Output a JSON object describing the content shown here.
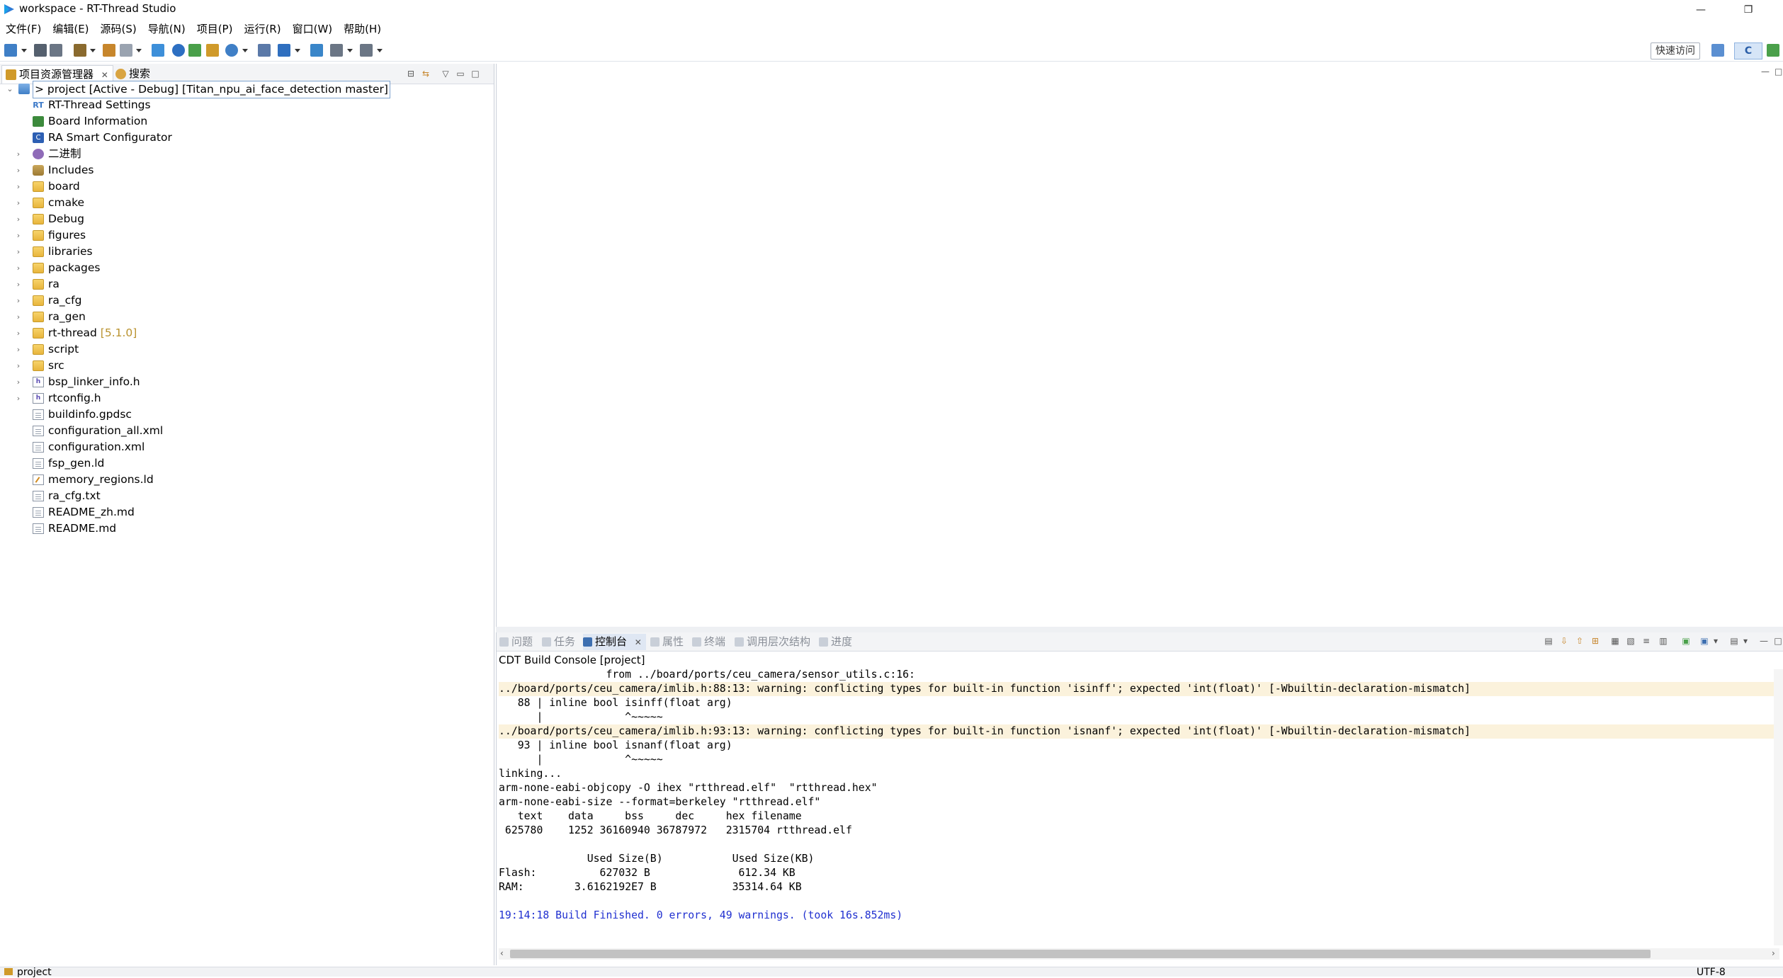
{
  "window": {
    "title": "workspace - RT-Thread Studio"
  },
  "menu": [
    "文件(F)",
    "编辑(E)",
    "源码(S)",
    "导航(N)",
    "项目(P)",
    "运行(R)",
    "窗口(W)",
    "帮助(H)"
  ],
  "toolbar": {
    "quick_access": "快速访问",
    "perspective_label": "C"
  },
  "left_panel": {
    "tabs": [
      {
        "label": "项目资源管理器",
        "active": true
      },
      {
        "label": "搜索",
        "active": false
      }
    ],
    "tree": [
      {
        "label": "> project",
        "suffix": "[Active - Debug] [Titan_npu_ai_face_detection master]",
        "icon": "project-icon",
        "level": 0,
        "expanded": true
      },
      {
        "label": "RT-Thread Settings",
        "icon": "rt-thread-settings-icon",
        "level": 1
      },
      {
        "label": "Board Information",
        "icon": "board-icon",
        "level": 1
      },
      {
        "label": "RA Smart Configurator",
        "icon": "ra-configurator-icon",
        "level": 1
      },
      {
        "label": "二进制",
        "icon": "binaries-icon",
        "level": 1,
        "collapsed": true
      },
      {
        "label": "Includes",
        "icon": "includes-icon",
        "level": 1,
        "collapsed": true
      },
      {
        "label": "board",
        "icon": "folder-icon",
        "level": 1,
        "collapsed": true
      },
      {
        "label": "cmake",
        "icon": "folder-icon",
        "level": 1,
        "collapsed": true
      },
      {
        "label": "Debug",
        "icon": "folder-icon",
        "level": 1,
        "collapsed": true
      },
      {
        "label": "figures",
        "icon": "folder-icon",
        "level": 1,
        "collapsed": true
      },
      {
        "label": "libraries",
        "icon": "folder-icon",
        "level": 1,
        "collapsed": true
      },
      {
        "label": "packages",
        "icon": "folder-icon",
        "level": 1,
        "collapsed": true
      },
      {
        "label": "ra",
        "icon": "folder-icon",
        "level": 1,
        "collapsed": true
      },
      {
        "label": "ra_cfg",
        "icon": "folder-icon",
        "level": 1,
        "collapsed": true
      },
      {
        "label": "ra_gen",
        "icon": "folder-icon",
        "level": 1,
        "collapsed": true
      },
      {
        "label": "rt-thread",
        "version": "[5.1.0]",
        "icon": "folder-icon",
        "level": 1,
        "collapsed": true
      },
      {
        "label": "script",
        "icon": "folder-icon",
        "level": 1,
        "collapsed": true
      },
      {
        "label": "src",
        "icon": "folder-icon",
        "level": 1,
        "collapsed": true
      },
      {
        "label": "bsp_linker_info.h",
        "icon": "header-file-icon",
        "level": 1,
        "collapsed": true
      },
      {
        "label": "rtconfig.h",
        "icon": "header-file-icon",
        "level": 1,
        "collapsed": true
      },
      {
        "label": "buildinfo.gpdsc",
        "icon": "file-icon",
        "level": 1
      },
      {
        "label": "configuration_all.xml",
        "icon": "file-icon",
        "level": 1
      },
      {
        "label": "configuration.xml",
        "icon": "file-icon",
        "level": 1
      },
      {
        "label": "fsp_gen.ld",
        "icon": "file-icon",
        "level": 1
      },
      {
        "label": "memory_regions.ld",
        "icon": "linker-file-icon",
        "level": 1
      },
      {
        "label": "ra_cfg.txt",
        "icon": "file-icon",
        "level": 1
      },
      {
        "label": "README_zh.md",
        "icon": "file-icon",
        "level": 1
      },
      {
        "label": "README.md",
        "icon": "file-icon",
        "level": 1
      }
    ]
  },
  "console_panel": {
    "tabs": [
      {
        "label": "问题",
        "active": false
      },
      {
        "label": "任务",
        "active": false
      },
      {
        "label": "控制台",
        "active": true
      },
      {
        "label": "属性",
        "active": false
      },
      {
        "label": "终端",
        "active": false
      },
      {
        "label": "调用层次结构",
        "active": false
      },
      {
        "label": "进度",
        "active": false
      }
    ],
    "title": "CDT Build Console [project]",
    "lines": [
      {
        "text": "                 from ../board/ports/ceu_camera/sensor_utils.c:16:",
        "kind": "normal"
      },
      {
        "text": "../board/ports/ceu_camera/imlib.h:88:13: warning: conflicting types for built-in function 'isinff'; expected 'int(float)' [-Wbuiltin-declaration-mismatch]",
        "kind": "warn"
      },
      {
        "text": "   88 | inline bool isinff(float arg)",
        "kind": "normal"
      },
      {
        "text": "      |             ^~~~~~",
        "kind": "normal"
      },
      {
        "text": "../board/ports/ceu_camera/imlib.h:93:13: warning: conflicting types for built-in function 'isnanf'; expected 'int(float)' [-Wbuiltin-declaration-mismatch]",
        "kind": "warn"
      },
      {
        "text": "   93 | inline bool isnanf(float arg)",
        "kind": "normal"
      },
      {
        "text": "      |             ^~~~~~",
        "kind": "normal"
      },
      {
        "text": "linking...",
        "kind": "normal"
      },
      {
        "text": "arm-none-eabi-objcopy -O ihex \"rtthread.elf\"  \"rtthread.hex\"",
        "kind": "normal"
      },
      {
        "text": "arm-none-eabi-size --format=berkeley \"rtthread.elf\"",
        "kind": "normal"
      },
      {
        "text": "   text    data     bss     dec     hex filename",
        "kind": "normal"
      },
      {
        "text": " 625780    1252 36160940 36787972   2315704 rtthread.elf",
        "kind": "normal"
      },
      {
        "text": "",
        "kind": "normal"
      },
      {
        "text": "              Used Size(B)           Used Size(KB)",
        "kind": "normal"
      },
      {
        "text": "Flash:          627032 B              612.34 KB",
        "kind": "normal"
      },
      {
        "text": "RAM:        3.6162192E7 B            35314.64 KB",
        "kind": "normal"
      },
      {
        "text": "",
        "kind": "normal"
      },
      {
        "text": "19:14:18 Build Finished. 0 errors, 49 warnings. (took 16s.852ms)",
        "kind": "blue"
      }
    ]
  },
  "status_bar": {
    "selection": "project",
    "encoding": "UTF-8"
  },
  "colors": {
    "accent": "#3a78c8",
    "warning_bg": "#fbf2dc",
    "finish_text": "#2030d0",
    "version_text": "#b9922e"
  }
}
